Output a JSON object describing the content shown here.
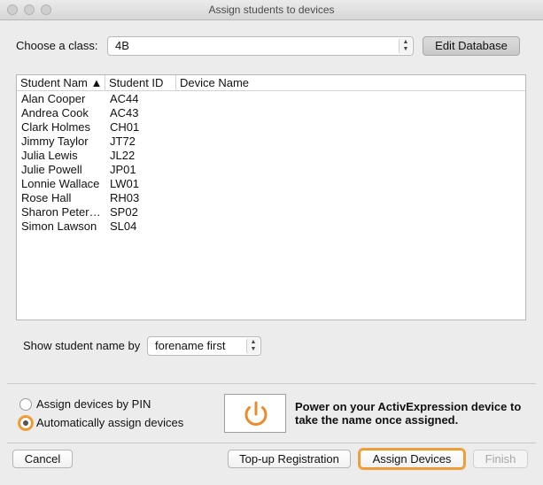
{
  "window": {
    "title": "Assign students to devices"
  },
  "class_selector": {
    "label": "Choose a class:",
    "value": "4B",
    "edit_button": "Edit Database"
  },
  "table": {
    "columns": [
      "Student Nam ▲",
      "Student ID",
      "Device Name"
    ],
    "rows": [
      {
        "name": "Alan Cooper",
        "id": "AC44",
        "device": ""
      },
      {
        "name": "Andrea Cook",
        "id": "AC43",
        "device": ""
      },
      {
        "name": "Clark Holmes",
        "id": "CH01",
        "device": ""
      },
      {
        "name": "Jimmy Taylor",
        "id": "JT72",
        "device": ""
      },
      {
        "name": "Julia Lewis",
        "id": "JL22",
        "device": ""
      },
      {
        "name": "Julie Powell",
        "id": "JP01",
        "device": ""
      },
      {
        "name": "Lonnie Wallace",
        "id": "LW01",
        "device": ""
      },
      {
        "name": "Rose Hall",
        "id": "RH03",
        "device": ""
      },
      {
        "name": "Sharon Peter…",
        "id": "SP02",
        "device": ""
      },
      {
        "name": "Simon Lawson",
        "id": "SL04",
        "device": ""
      }
    ]
  },
  "name_order": {
    "label": "Show student name by",
    "value": "forename first"
  },
  "assign_mode": {
    "options": [
      "Assign devices by PIN",
      "Automatically assign devices"
    ],
    "selected": "Automatically assign devices"
  },
  "power": {
    "icon": "power-icon",
    "message": "Power on your ActivExpression device to take the name once assigned."
  },
  "footer": {
    "cancel": "Cancel",
    "topup": "Top-up Registration",
    "assign": "Assign Devices",
    "finish": "Finish"
  },
  "colors": {
    "accent": "#f0a13d",
    "power_icon": "#e88d2b"
  }
}
